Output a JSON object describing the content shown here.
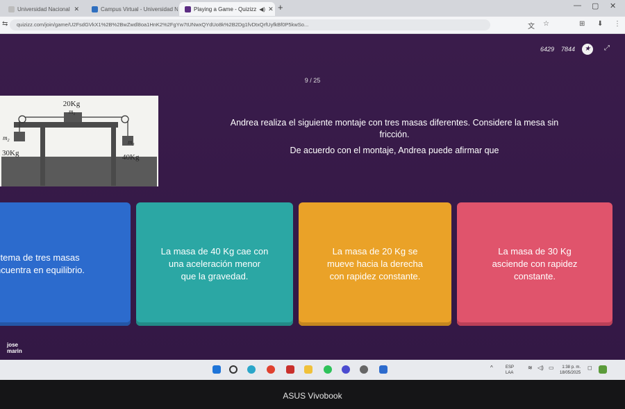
{
  "browser": {
    "tabs": [
      {
        "label": "Universidad Nacional",
        "active": false
      },
      {
        "label": "Campus Virtual - Universidad N",
        "active": false
      },
      {
        "label": "Playing a Game - Quizizz",
        "active": true
      }
    ],
    "new_tab": "+",
    "url": "quizizz.com/join/game/U2FsdGVkX1%2B%2BwZwdl8oa1HnK2%2FgYw7tUNwxQYdUo8k%2B2Dg1fvDtxQrfUyfkBf0P5kwSo..."
  },
  "header": {
    "accuracy": "6429",
    "score": "7844",
    "star_icon": "star-icon",
    "expand_icon": "expand-icon"
  },
  "question": {
    "counter": "9 / 25",
    "line1": "Andrea realiza el siguiente montaje con tres masas diferentes. Considere la mesa sin",
    "line2": "fricción.",
    "line3": "De acuerdo con el montaje, Andrea puede afirmar que"
  },
  "figure": {
    "top_mass": "20Kg",
    "left_mass": "30Kg",
    "right_mass": "40Kg",
    "m1": "m",
    "m1_sub": "1",
    "m2": "m",
    "m2_sub": "2",
    "m3": "m",
    "m3_sub": "3"
  },
  "options": [
    {
      "line1": "stema de tres masas",
      "line2": "ncuentra en equilibrio.",
      "line3": "",
      "color": "#2c6bcd"
    },
    {
      "line1": "La masa de 40 Kg cae con",
      "line2": "una aceleración menor",
      "line3": "que la gravedad.",
      "color": "#2ba7a4"
    },
    {
      "line1": "La masa de 20 Kg se",
      "line2": "mueve hacia la derecha",
      "line3": "con rapidez constante.",
      "color": "#eaa228"
    },
    {
      "line1": "La masa de 30 Kg",
      "line2": "asciende con rapidez",
      "line3": "constante.",
      "color": "#e0546c"
    }
  ],
  "player": {
    "first": "jose",
    "last": "marin"
  },
  "taskbar": {
    "lang_top": "ESP",
    "lang_bottom": "LAA",
    "time": "1:38 p. m.",
    "date": "18/05/2025"
  },
  "device": {
    "brand": "ASUS Vivobook"
  }
}
